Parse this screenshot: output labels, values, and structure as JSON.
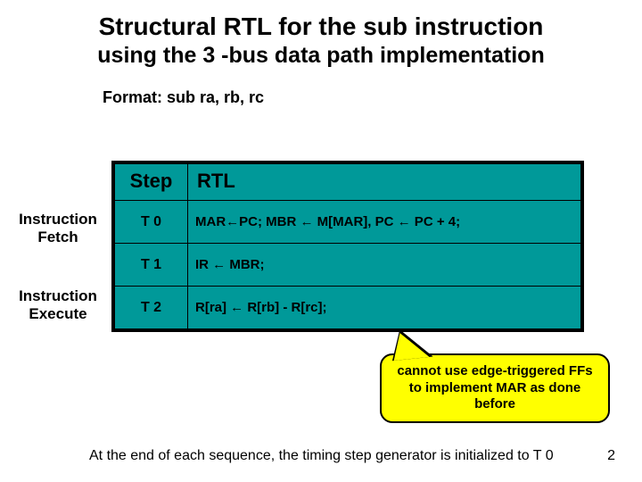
{
  "title": "Structural RTL for the sub instruction",
  "subtitle": "using the 3 -bus data path implementation",
  "format": "Format:  sub ra, rb, rc",
  "labels": {
    "fetch": "Instruction Fetch",
    "execute": "Instruction Execute"
  },
  "table": {
    "head_step": "Step",
    "head_rtl": "RTL",
    "rows": [
      {
        "step": "T 0",
        "rtl": "MAR←PC; MBR ← M[MAR],  PC ← PC + 4;"
      },
      {
        "step": "T 1",
        "rtl": "IR ← MBR;"
      },
      {
        "step": "T 2",
        "rtl": "R[ra] ← R[rb] - R[rc];"
      }
    ]
  },
  "callout": "cannot use edge-triggered FFs to implement MAR as done before",
  "footer_text": "At the end of each sequence, the timing step generator is initialized to T 0",
  "page_num": "2"
}
